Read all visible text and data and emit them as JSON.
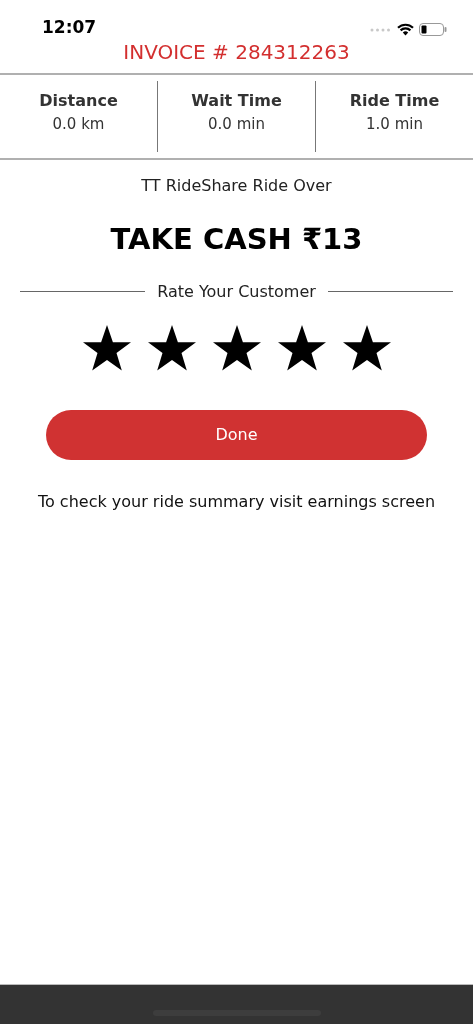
{
  "status_bar": {
    "time": "12:07"
  },
  "invoice_title": "INVOICE # 284312263",
  "stats": [
    {
      "label": "Distance",
      "value": "0.0 km"
    },
    {
      "label": "Wait Time",
      "value": "0.0 min"
    },
    {
      "label": "Ride Time",
      "value": "1.0 min"
    }
  ],
  "ride_status": "TT RideShare Ride Over",
  "amount": "TAKE CASH ₹13",
  "rating": {
    "label": "Rate Your Customer",
    "stars": 5
  },
  "done_button": "Done",
  "note": "To check your ride summary visit earnings screen"
}
